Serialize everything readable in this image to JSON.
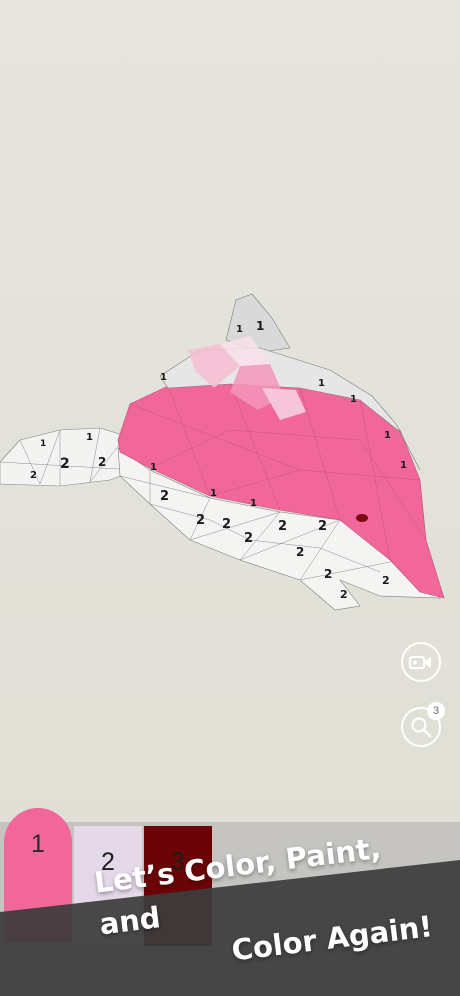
{
  "artwork": {
    "subject": "dolphin",
    "numbers": {
      "one": "1",
      "two": "2"
    }
  },
  "tools": {
    "record_icon": "video-camera-icon",
    "hint_icon": "magnifier-icon",
    "hint_count": "3"
  },
  "palette": {
    "colors": [
      {
        "label": "1",
        "color": "#f2679a",
        "text_color": "#2a2a2a",
        "selected": true
      },
      {
        "label": "2",
        "color": "#e5d8e9",
        "text_color": "#1e1e1e",
        "selected": false
      },
      {
        "label": "3",
        "color": "#6b0407",
        "text_color": "#1c1c1c",
        "selected": false
      }
    ]
  },
  "banner": {
    "line1": "Let’s Color, Paint, and",
    "line2": "Color Again!",
    "color": "#3c3c3c"
  }
}
